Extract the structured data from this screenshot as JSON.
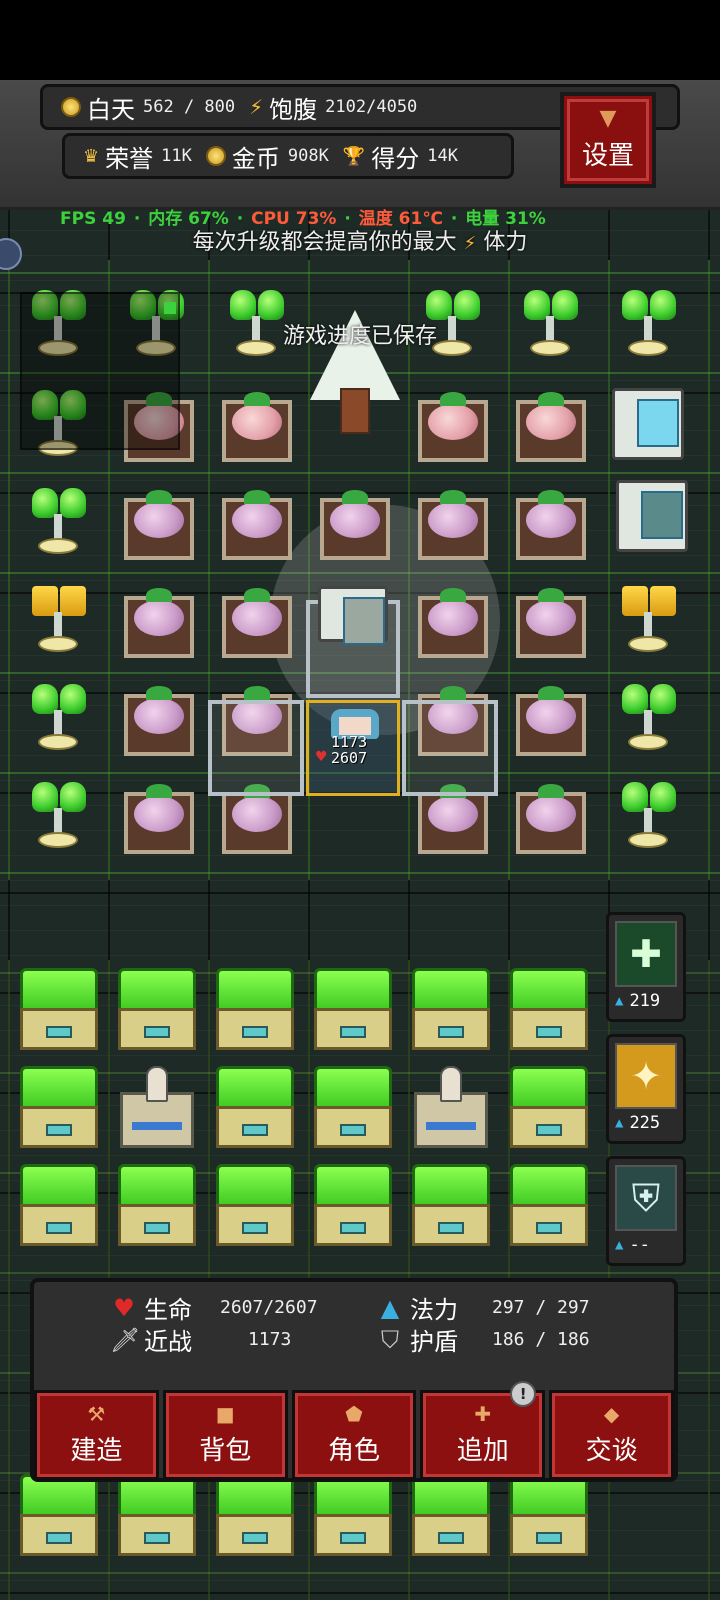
{
  "hud": {
    "day_label": "白天",
    "day_value": "562 / 800",
    "hunger_label": "饱腹",
    "hunger_value": "2102/4050",
    "honor_label": "荣誉",
    "honor_value": "11K",
    "gold_label": "金币",
    "gold_value": "908K",
    "score_label": "得分",
    "score_value": "14K",
    "settings_label": "设置"
  },
  "perf": {
    "fps": "FPS 49",
    "mem": "内存 67%",
    "cpu": "CPU 73%",
    "temp": "温度 61℃",
    "battery": "电量 31%",
    "sep": " · ",
    "colors": {
      "fps": "#3dd13d",
      "mem": "#3dd13d",
      "cpu": "#ff5a3a",
      "temp": "#ff5a3a",
      "battery": "#3dd13d"
    }
  },
  "hint": {
    "text_before": "每次升级都会提高你的最大",
    "text_after": "体力"
  },
  "toast": "游戏进度已保存",
  "player": {
    "attack": "1173",
    "hp": "2607"
  },
  "skills": [
    {
      "icon": "cross-burst-icon",
      "cost": "219"
    },
    {
      "icon": "golden-shield-sparkle-icon",
      "cost": "225"
    },
    {
      "icon": "shield-icon",
      "cost": "--"
    }
  ],
  "stats": {
    "life_label": "生命",
    "life_value": "2607/2607",
    "mana_label": "法力",
    "mana_value": "297 / 297",
    "melee_label": "近战",
    "melee_value": "1173",
    "shield_label": "护盾",
    "shield_value": "186 / 186"
  },
  "menu": [
    {
      "label": "建造",
      "icon": "hammer-icon"
    },
    {
      "label": "背包",
      "icon": "bag-icon"
    },
    {
      "label": "角色",
      "icon": "character-icon"
    },
    {
      "label": "追加",
      "icon": "plus-icon",
      "badge": "!"
    },
    {
      "label": "交谈",
      "icon": "speech-icon"
    }
  ]
}
